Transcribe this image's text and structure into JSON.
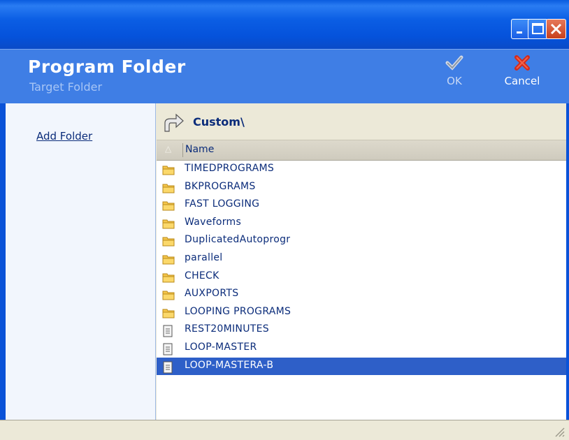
{
  "window": {
    "buttons": {
      "minimize_icon": "minimize-icon",
      "maximize_icon": "maximize-icon",
      "close_icon": "close-icon"
    }
  },
  "header": {
    "title": "Program Folder",
    "subtitle": "Target Folder",
    "ok_label": "OK",
    "cancel_label": "Cancel"
  },
  "sidebar": {
    "add_folder": "Add Folder"
  },
  "path": {
    "current": "Custom\\"
  },
  "list": {
    "column": "Name",
    "sort_indicator": "△",
    "items": [
      {
        "name": "TIMEDPROGRAMS",
        "type": "folder"
      },
      {
        "name": "BKPROGRAMS",
        "type": "folder"
      },
      {
        "name": "FAST LOGGING",
        "type": "folder"
      },
      {
        "name": "Waveforms",
        "type": "folder"
      },
      {
        "name": "DuplicatedAutoprogr",
        "type": "folder"
      },
      {
        "name": "parallel",
        "type": "folder"
      },
      {
        "name": "CHECK",
        "type": "folder"
      },
      {
        "name": "AUXPORTS",
        "type": "folder"
      },
      {
        "name": "LOOPING PROGRAMS",
        "type": "folder"
      },
      {
        "name": "REST20MINUTES",
        "type": "file"
      },
      {
        "name": "LOOP-MASTER",
        "type": "file"
      },
      {
        "name": "LOOP-MASTERA-B",
        "type": "file",
        "selected": true
      }
    ]
  },
  "colors": {
    "header": "#3f7ee5",
    "selection": "#2e5fc8",
    "text": "#0b2c7a"
  }
}
